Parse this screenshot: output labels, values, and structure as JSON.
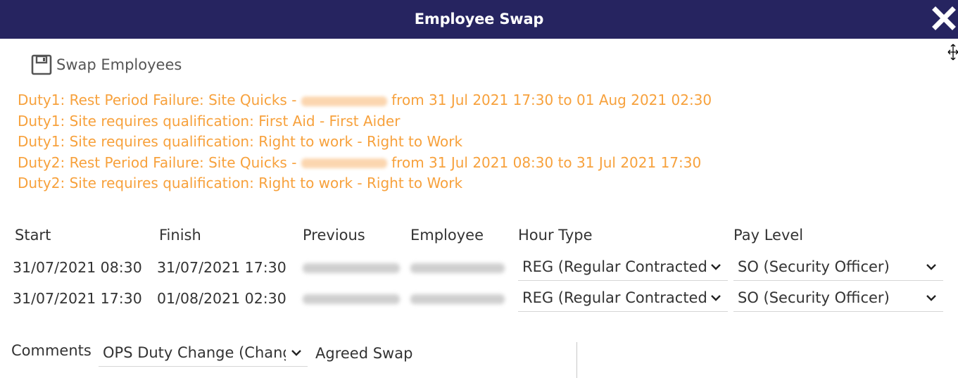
{
  "dialog": {
    "title": "Employee Swap"
  },
  "toolbar": {
    "swap_label": "Swap Employees"
  },
  "warnings": [
    {
      "prefix": "Duty1: Rest Period Failure: Site Quicks - ",
      "has_redacted_name": true,
      "suffix": " from 31 Jul 2021 17:30 to 01 Aug 2021 02:30"
    },
    {
      "prefix": "Duty1: Site requires qualification: First Aid - First Aider",
      "has_redacted_name": false,
      "suffix": ""
    },
    {
      "prefix": "Duty1: Site requires qualification: Right to work - Right to Work",
      "has_redacted_name": false,
      "suffix": ""
    },
    {
      "prefix": "Duty2: Rest Period Failure: Site Quicks - ",
      "has_redacted_name": true,
      "suffix": " from 31 Jul 2021 08:30 to 31 Jul 2021 17:30"
    },
    {
      "prefix": "Duty2: Site requires qualification: Right to work - Right to Work",
      "has_redacted_name": false,
      "suffix": ""
    }
  ],
  "table": {
    "headers": {
      "start": "Start",
      "finish": "Finish",
      "previous": "Previous",
      "employee": "Employee",
      "hour_type": "Hour Type",
      "pay_level": "Pay Level"
    },
    "rows": [
      {
        "start": "31/07/2021 08:30",
        "finish": "31/07/2021 17:30",
        "hour_type": "REG (Regular Contracted)",
        "pay_level": "SO (Security Officer)"
      },
      {
        "start": "31/07/2021 17:30",
        "finish": "01/08/2021 02:30",
        "hour_type": "REG (Regular Contracted)",
        "pay_level": "SO (Security Officer)"
      }
    ]
  },
  "comments": {
    "label": "Comments",
    "selected": "OPS Duty Change (Change)",
    "text": "Agreed Swap"
  },
  "colors": {
    "titlebar": "#262460",
    "warning": "#f7a13c"
  },
  "icons": {
    "close": "close-icon",
    "swap": "floppy-disk-icon",
    "cursor": "move-cursor-icon",
    "dropdown": "chevron-down-icon"
  }
}
